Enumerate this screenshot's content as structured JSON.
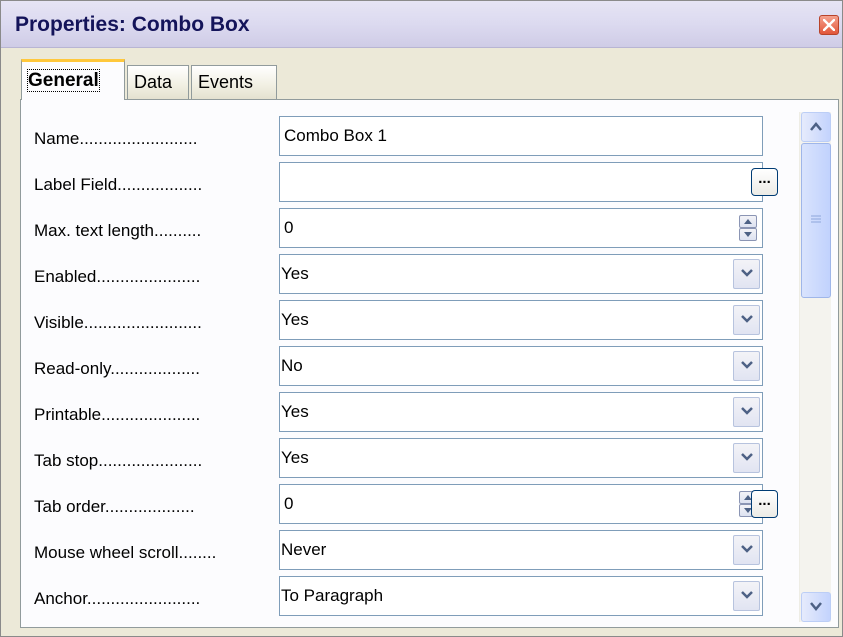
{
  "window": {
    "title": "Properties: Combo Box"
  },
  "tabs": [
    {
      "label": "General",
      "active": true
    },
    {
      "label": "Data",
      "active": false
    },
    {
      "label": "Events",
      "active": false
    }
  ],
  "properties": [
    {
      "label": "Name.........................",
      "value": "Combo Box 1",
      "control": "text"
    },
    {
      "label": "Label Field..................",
      "value": "",
      "control": "text-ellipsis"
    },
    {
      "label": "Max. text length..........",
      "value": "0",
      "control": "spin"
    },
    {
      "label": "Enabled......................",
      "value": "Yes",
      "control": "dropdown"
    },
    {
      "label": "Visible.........................",
      "value": "Yes",
      "control": "dropdown"
    },
    {
      "label": "Read-only...................",
      "value": "No",
      "control": "dropdown"
    },
    {
      "label": "Printable.....................",
      "value": "Yes",
      "control": "dropdown"
    },
    {
      "label": "Tab stop......................",
      "value": "Yes",
      "control": "dropdown"
    },
    {
      "label": "Tab order...................",
      "value": "0",
      "control": "spin-ellipsis"
    },
    {
      "label": "Mouse wheel scroll........",
      "value": "Never",
      "control": "dropdown"
    },
    {
      "label": "Anchor........................",
      "value": "To Paragraph",
      "control": "dropdown"
    }
  ],
  "ellipsis_label": "...",
  "colors": {
    "title_text": "#14145a",
    "close_button": "#e2563a",
    "active_tab_highlight": "#ffc83c",
    "field_border": "#7f9db9"
  },
  "icons": {
    "close": "close-icon",
    "dropdown": "chevron-down-icon",
    "spin": "spin-arrows-icon",
    "scroll_up": "arrow-up-icon",
    "scroll_down": "arrow-down-icon",
    "grip": "grip-icon"
  }
}
